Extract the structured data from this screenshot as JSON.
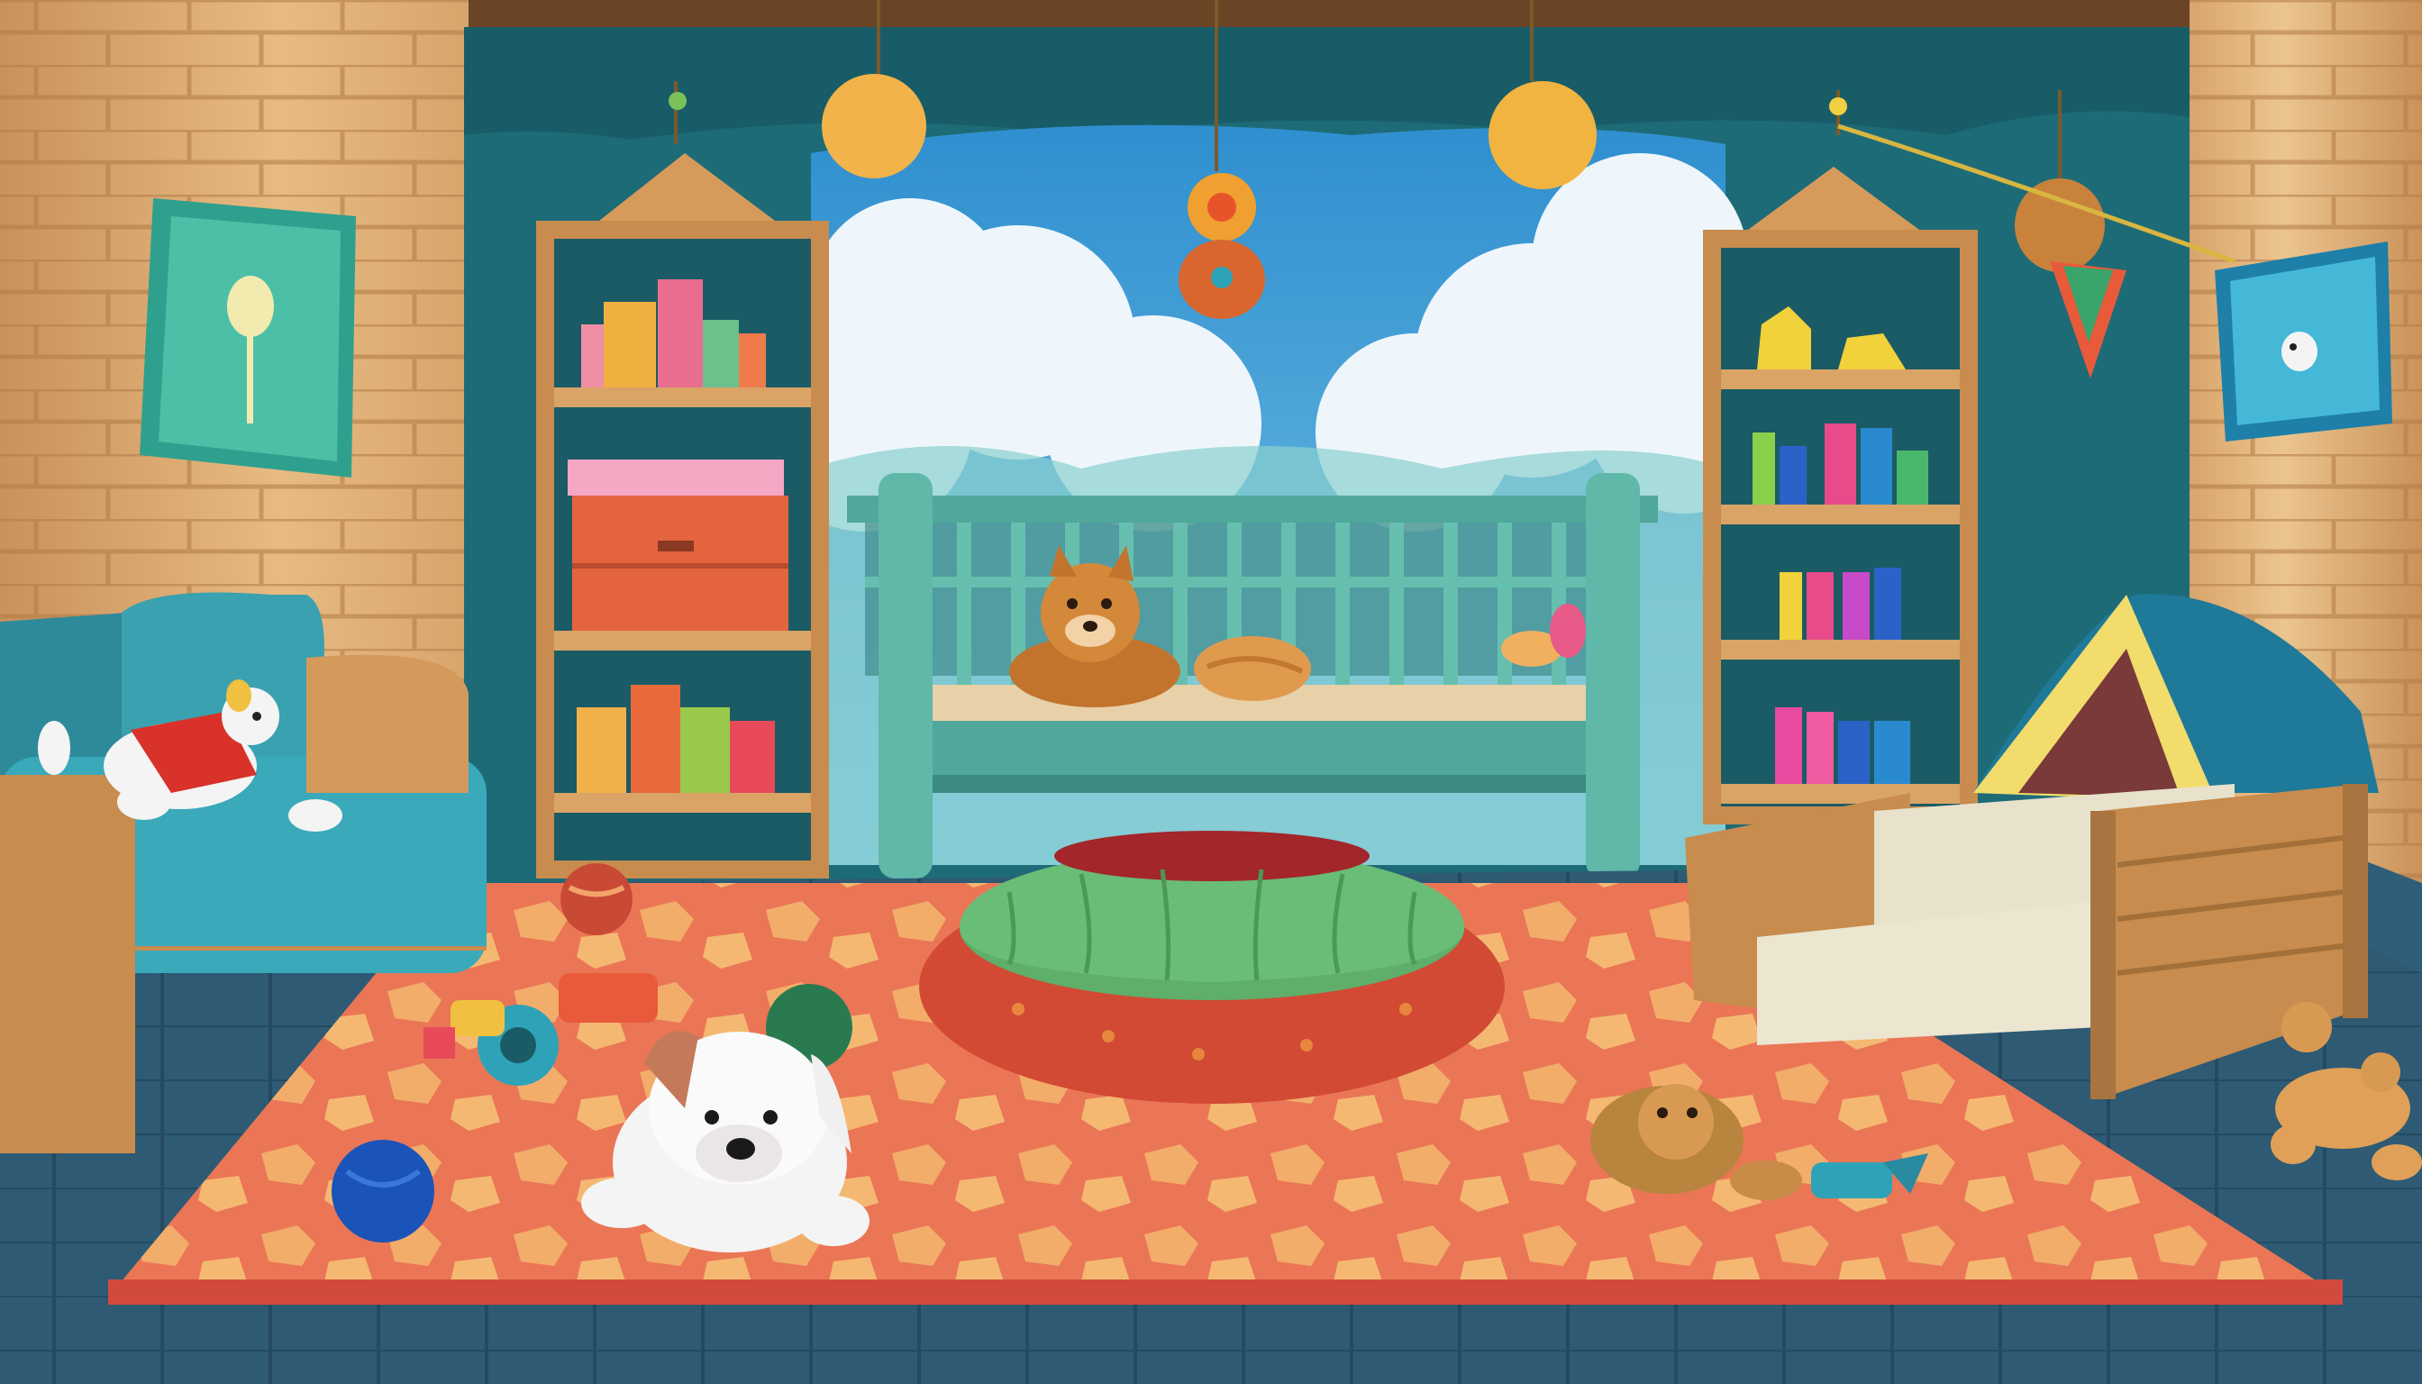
{
  "scene": {
    "description_name": "pet-nursery-room",
    "palette": {
      "wall_wood": "#e3b57c",
      "wall_wood_dark": "#b88752",
      "curtain": "#1e6f78",
      "sky": "#3fa2d6",
      "cloud": "#eef6fb",
      "crib": "#5fb8a8",
      "rug": "#ec7a58",
      "rug_spot": "#f3b26f",
      "floor": "#2f5f78",
      "sofa": "#3a9fb0",
      "shelf": "#d49b5c",
      "pet_bed_outer": "#d8503a",
      "pet_bed_rim": "#5fae6a",
      "tent": "#f0d868",
      "tent_cover": "#1f7a98"
    },
    "icons": [
      "puppy-plush",
      "teddy-fox-plush",
      "dog-plush-on-sofa",
      "blue-ball",
      "green-ball",
      "red-ball",
      "toy-car",
      "rope-toy",
      "plush-lion",
      "hanging-ornament",
      "pennant-flag"
    ]
  }
}
